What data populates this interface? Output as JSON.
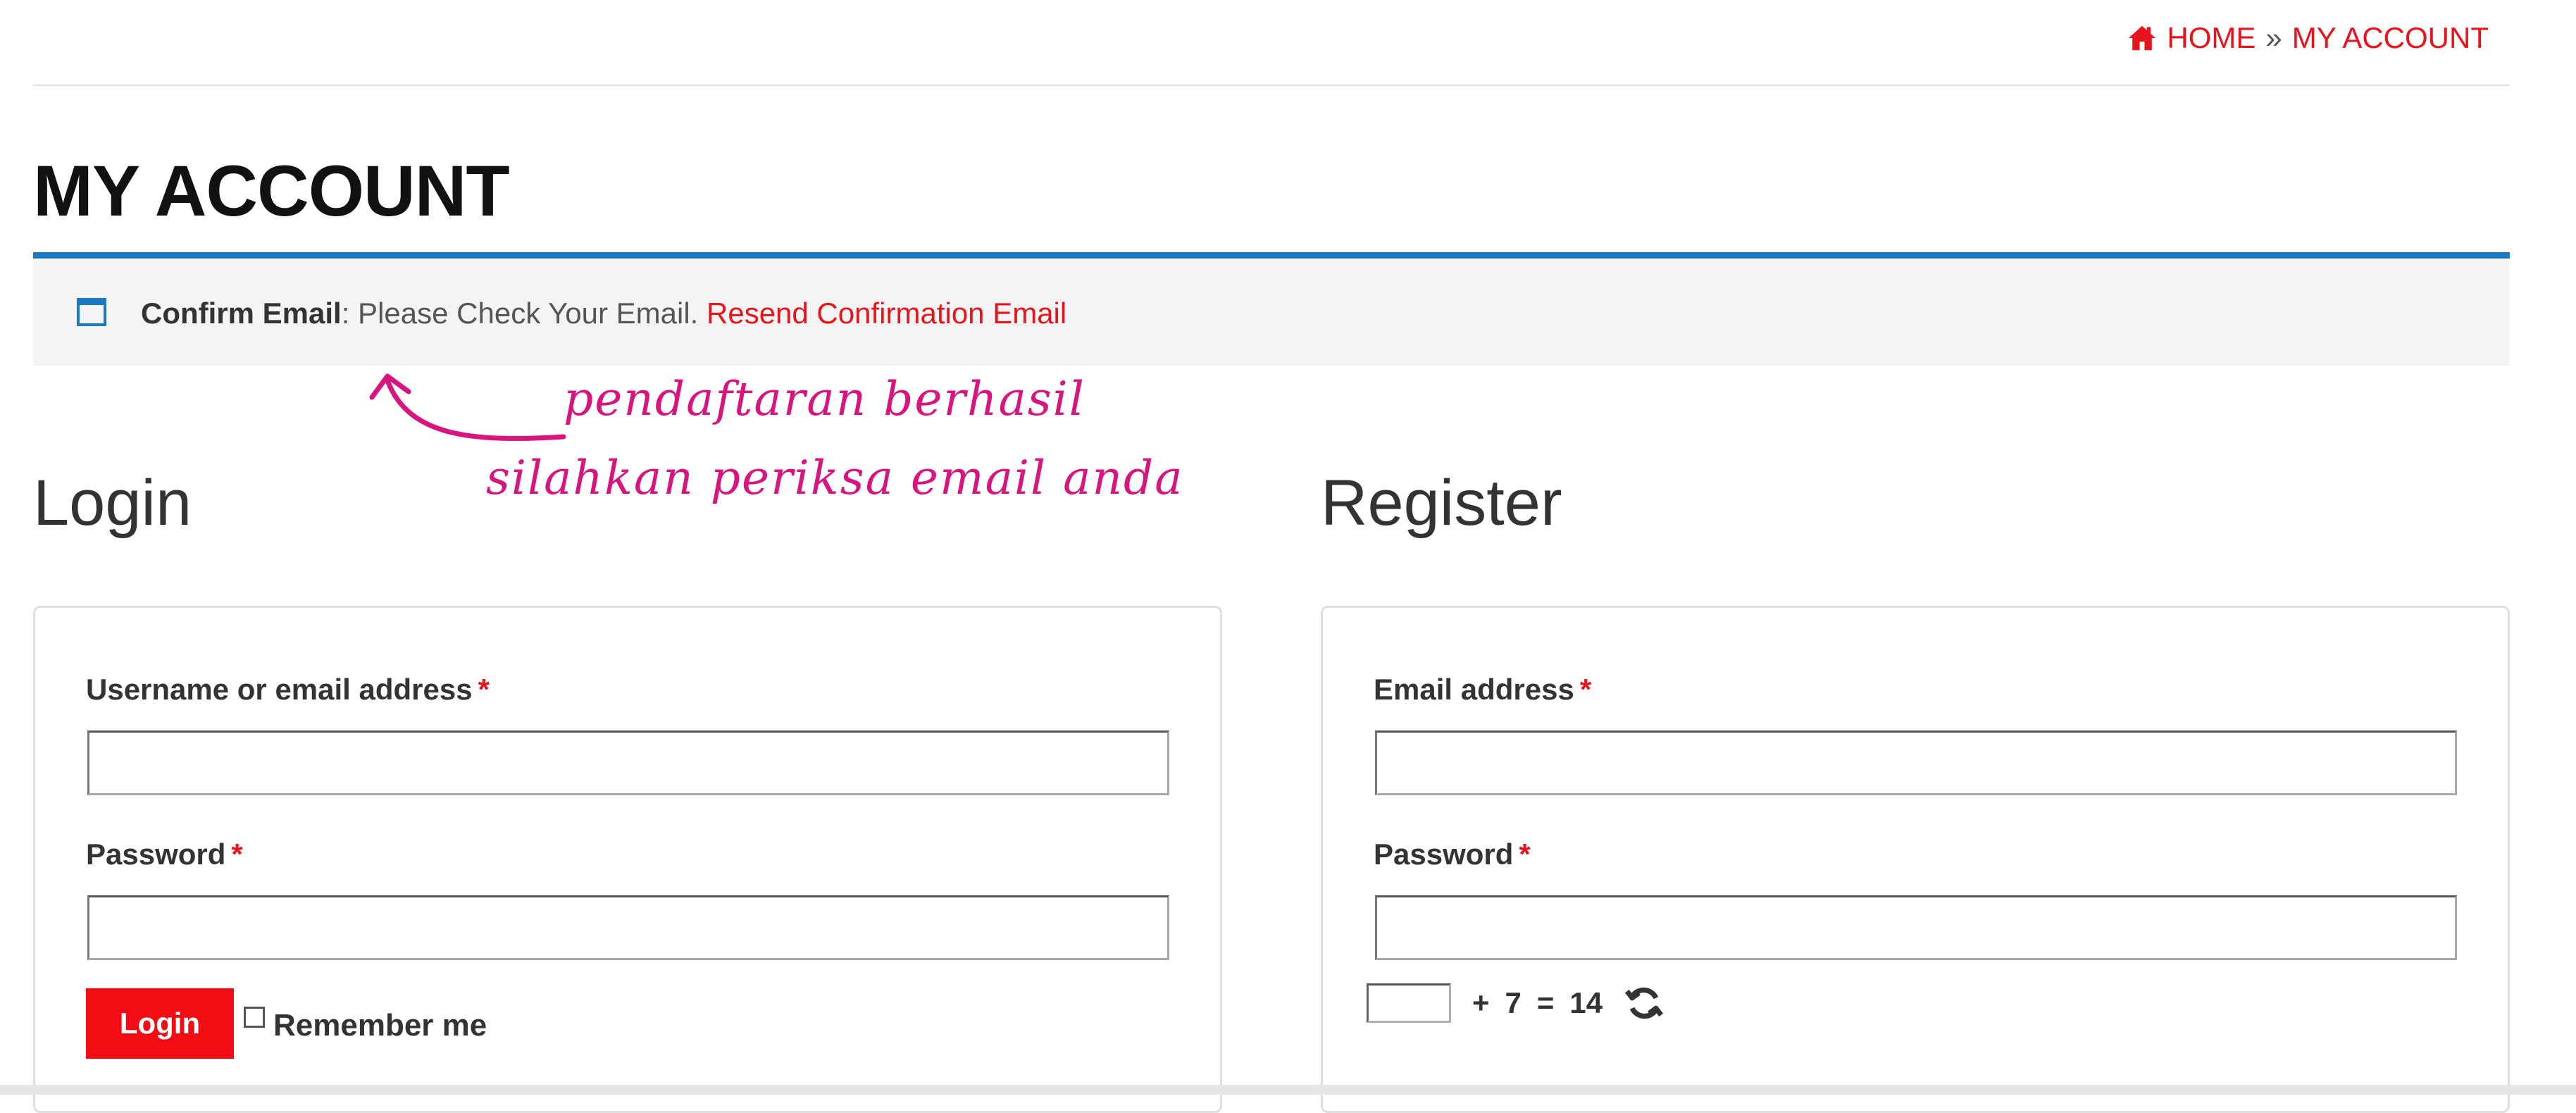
{
  "breadcrumb": {
    "icon": "home-icon",
    "home": "HOME",
    "separator": "»",
    "current": "MY ACCOUNT"
  },
  "page": {
    "title": "MY ACCOUNT"
  },
  "notice": {
    "icon": "window-icon",
    "strong": "Confirm Email",
    "message": ": Please Check Your Email.",
    "link": "Resend Confirmation Email"
  },
  "annotation": {
    "line1": "pendaftaran berhasil",
    "line2": "silahkan periksa email anda",
    "color": "#d6157f"
  },
  "login": {
    "heading": "Login",
    "username_label": "Username or email address",
    "password_label": "Password",
    "required_mark": "*",
    "button": "Login",
    "remember": "Remember me"
  },
  "register": {
    "heading": "Register",
    "email_label": "Email address",
    "password_label": "Password",
    "required_mark": "*",
    "captcha": {
      "operator": "+",
      "operand": "7",
      "equals": "=",
      "result": "14"
    },
    "refresh_icon": "refresh-icon"
  },
  "colors": {
    "accent_red": "#e8141b",
    "accent_blue": "#1b77bf",
    "button_red": "#f20d14"
  }
}
